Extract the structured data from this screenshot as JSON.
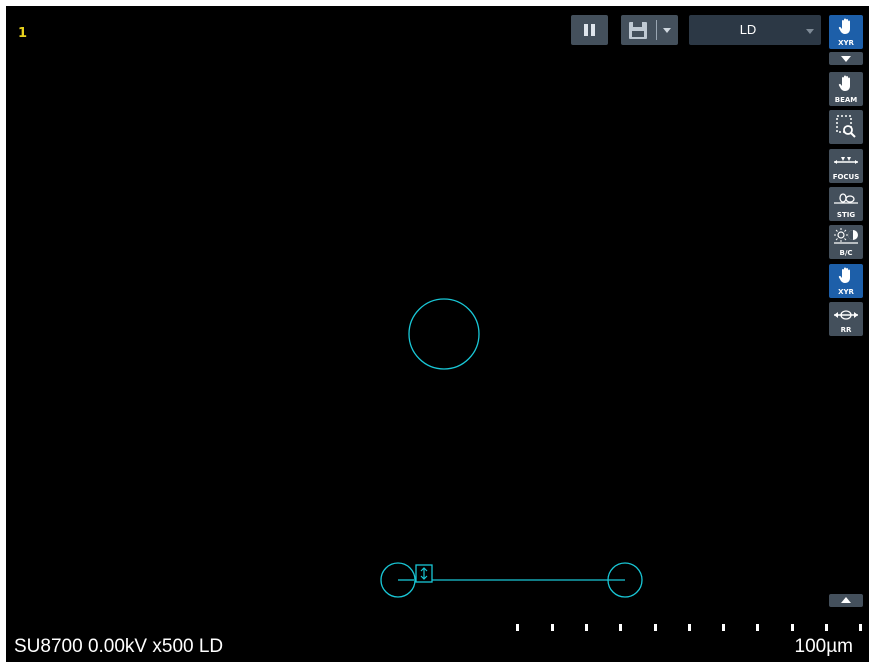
{
  "frame_number": "1",
  "toolbar": {
    "pause_icon": "pause-icon",
    "save_icon": "save-icon",
    "mode_select_value": "LD"
  },
  "tools": [
    {
      "name": "xyr-stage-hand",
      "label": "XYR",
      "icon": "hand-icon",
      "active": true
    },
    {
      "name": "beam-shift",
      "label": "BEAM",
      "icon": "hand-icon",
      "active": false
    },
    {
      "name": "zoom-select",
      "label": "",
      "icon": "zoom-box-icon",
      "active": false
    },
    {
      "name": "focus",
      "label": "FOCUS",
      "icon": "focus-icon",
      "active": false
    },
    {
      "name": "stig",
      "label": "STIG",
      "icon": "stig-icon",
      "active": false
    },
    {
      "name": "brightness-contrast",
      "label": "B/C",
      "icon": "brightness-contrast-icon",
      "active": false
    },
    {
      "name": "xyr-move",
      "label": "XYR",
      "icon": "hand-icon",
      "active": true
    },
    {
      "name": "raster-rotation",
      "label": "RR",
      "icon": "rotation-icon",
      "active": false
    }
  ],
  "status": {
    "info": "SU8700 0.00kV x500 LD",
    "scale": "100µm"
  },
  "colors": {
    "overlay": "#19c7d6",
    "frame_number": "#e8d21d",
    "active_tool": "#1d5fa9",
    "tool": "#44505c"
  }
}
